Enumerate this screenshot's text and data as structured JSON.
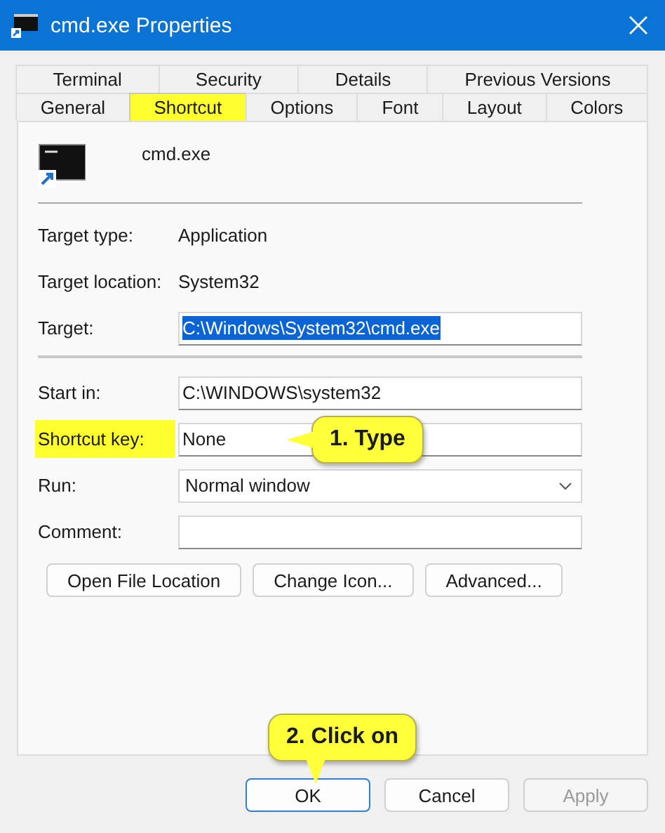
{
  "window": {
    "title": "cmd.exe Properties"
  },
  "tab_rows": [
    [
      {
        "label": "Terminal",
        "selected": false,
        "highlighted": false
      },
      {
        "label": "Security",
        "selected": false,
        "highlighted": false
      },
      {
        "label": "Details",
        "selected": false,
        "highlighted": false
      },
      {
        "label": "Previous Versions",
        "selected": false,
        "highlighted": false
      }
    ],
    [
      {
        "label": "General",
        "selected": false,
        "highlighted": false
      },
      {
        "label": "Shortcut",
        "selected": true,
        "highlighted": true
      },
      {
        "label": "Options",
        "selected": false,
        "highlighted": false
      },
      {
        "label": "Font",
        "selected": false,
        "highlighted": false
      },
      {
        "label": "Layout",
        "selected": false,
        "highlighted": false
      },
      {
        "label": "Colors",
        "selected": false,
        "highlighted": false
      }
    ]
  ],
  "file_name": "cmd.exe",
  "fields": [
    {
      "kind": "info",
      "label": "Target type:",
      "value": "Application",
      "highlighted": false
    },
    {
      "kind": "info",
      "label": "Target location:",
      "value": "System32",
      "highlighted": false
    },
    {
      "kind": "input",
      "label": "Target:",
      "value": "C:\\Windows\\System32\\cmd.exe",
      "text_selected": true,
      "highlighted": false
    },
    {
      "kind": "divider"
    },
    {
      "kind": "input",
      "label": "Start in:",
      "value": "C:\\WINDOWS\\system32",
      "text_selected": false,
      "highlighted": false
    },
    {
      "kind": "input",
      "label": "Shortcut key:",
      "value": "None",
      "text_selected": false,
      "highlighted": true
    },
    {
      "kind": "dropdown",
      "label": "Run:",
      "value": "Normal window",
      "highlighted": false
    },
    {
      "kind": "input",
      "label": "Comment:",
      "highlighted": false
    }
  ],
  "action_buttons": [
    "Open File Location",
    "Change Icon...",
    "Advanced..."
  ],
  "dialog_buttons": [
    {
      "label": "OK",
      "default": true,
      "disabled": false
    },
    {
      "label": "Cancel",
      "default": false,
      "disabled": false
    },
    {
      "label": "Apply",
      "default": false,
      "disabled": true
    }
  ],
  "callouts": [
    {
      "text": "1. Type",
      "kind": "left"
    },
    {
      "text": "2. Click on",
      "kind": "down"
    }
  ]
}
